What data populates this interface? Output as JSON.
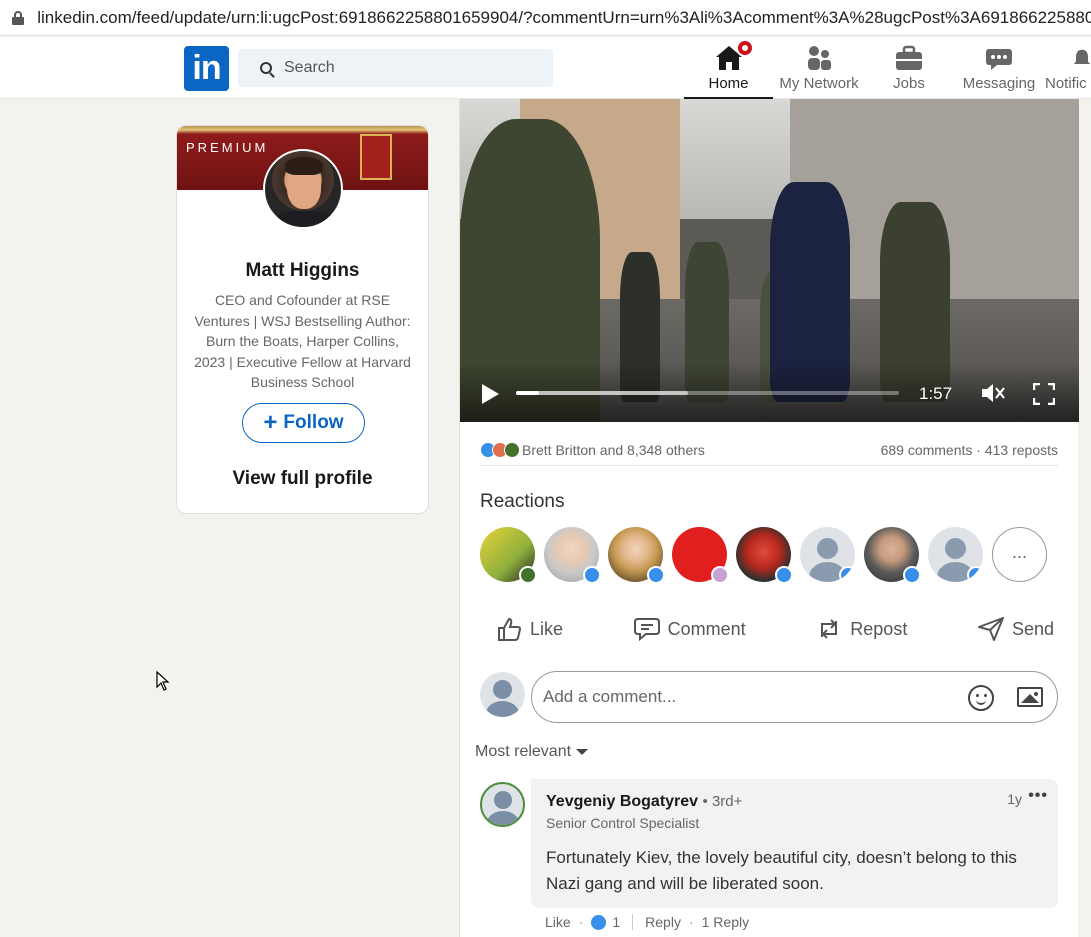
{
  "browser": {
    "url": "linkedin.com/feed/update/urn:li:ugcPost:6918662258801659904/?commentUrn=urn%3Ali%3Acomment%3A%28ugcPost%3A6918662258801659904"
  },
  "nav": {
    "logo_text": "in",
    "search_placeholder": "Search",
    "items": [
      {
        "label": "Home",
        "icon": "home-icon",
        "active": true
      },
      {
        "label": "My Network",
        "icon": "people-icon"
      },
      {
        "label": "Jobs",
        "icon": "briefcase-icon"
      },
      {
        "label": "Messaging",
        "icon": "chat-icon"
      },
      {
        "label": "Notific",
        "icon": "bell-icon"
      }
    ],
    "brand_color": "#0a66c2"
  },
  "profile_card": {
    "premium_label": "PREMIUM",
    "name": "Matt Higgins",
    "headline": "CEO and Cofounder at RSE Ventures | WSJ Bestselling Author: Burn the Boats, Harper Collins, 2023 | Executive Fellow at Harvard Business School",
    "follow_label": "Follow",
    "view_profile_label": "View full profile"
  },
  "video": {
    "time": "1:57",
    "progress": 0.06,
    "buffered": 0.45
  },
  "social": {
    "reacted_by": "Brett Britton and 8,348 others",
    "counts": "689 comments · 413 reposts"
  },
  "reactions": {
    "title": "Reactions",
    "more_label": "..."
  },
  "actions": {
    "like": "Like",
    "comment": "Comment",
    "repost": "Repost",
    "send": "Send"
  },
  "comment_box": {
    "placeholder": "Add a comment..."
  },
  "sort_label": "Most relevant",
  "comment": {
    "author": "Yevgeniy Bogatyrev",
    "degree": "• 3rd+",
    "title": "Senior Control Specialist",
    "ago": "1y",
    "text": "Fortunately Kiev, the lovely beautiful city, doesn’t belong to this Nazi gang and will be liberated soon.",
    "like_label": "Like",
    "like_count": "1",
    "reply_label": "Reply",
    "replies_label": "1 Reply"
  }
}
